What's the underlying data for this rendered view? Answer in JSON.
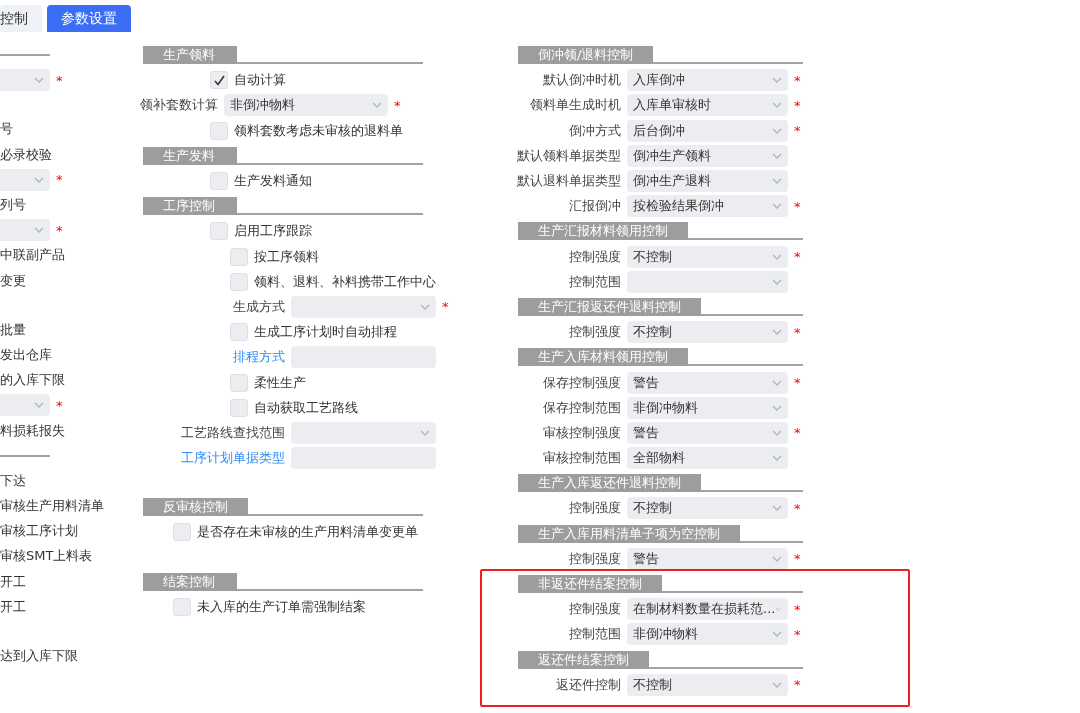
{
  "tabs": [
    {
      "label": "控制",
      "selected": false
    },
    {
      "label": "参数设置",
      "selected": true
    }
  ],
  "column_1": {
    "groups": [
      {
        "rule": true,
        "items": [
          {
            "kind": "select",
            "required_mark": "*"
          }
        ]
      },
      {
        "rule": false,
        "items": [
          {
            "kind": "text",
            "text": "号"
          },
          {
            "kind": "text",
            "text": "必录校验"
          },
          {
            "kind": "select",
            "required_mark": "*"
          },
          {
            "kind": "text",
            "text": "列号"
          },
          {
            "kind": "select",
            "required_mark": "*"
          },
          {
            "kind": "text",
            "text": "中联副产品"
          },
          {
            "kind": "text",
            "text": "变更"
          }
        ]
      },
      {
        "rule": false,
        "items": [
          {
            "kind": "text",
            "text": "批量"
          },
          {
            "kind": "text",
            "text": "发出仓库"
          },
          {
            "kind": "text",
            "text": "的入库下限"
          },
          {
            "kind": "select",
            "required_mark": "*"
          },
          {
            "kind": "text",
            "text": "料损耗报失"
          }
        ]
      },
      {
        "rule": true,
        "items": [
          {
            "kind": "text",
            "text": "下达"
          },
          {
            "kind": "text",
            "text": "审核生产用料清单"
          },
          {
            "kind": "text",
            "text": "审核工序计划"
          },
          {
            "kind": "text",
            "text": "审核SMT上料表"
          },
          {
            "kind": "text",
            "text": "开工"
          },
          {
            "kind": "text",
            "text": "开工"
          }
        ]
      },
      {
        "rule": false,
        "items": [
          {
            "kind": "text",
            "text": "达到入库下限"
          }
        ]
      }
    ]
  },
  "column_2": {
    "groups": [
      {
        "sections": [
          {
            "title": "生产领料",
            "items": [
              {
                "kind": "checkbox",
                "label": "自动计算",
                "checked": true
              },
              {
                "kind": "select",
                "label": "领补套数计算",
                "value": "非倒冲物料",
                "required_mark": "*"
              },
              {
                "kind": "checkbox",
                "label": "领料套数考虑未审核的退料单",
                "checked": false
              }
            ]
          },
          {
            "title": "生产发料",
            "items": [
              {
                "kind": "checkbox",
                "label": "生产发料通知",
                "checked": false
              }
            ]
          },
          {
            "title": "工序控制",
            "items": [
              {
                "kind": "checkbox",
                "label": "启用工序跟踪",
                "checked": false,
                "children": [
                  {
                    "kind": "checkbox",
                    "label": "按工序领料",
                    "checked": false
                  },
                  {
                    "kind": "checkbox",
                    "label": "领料、退料、补料携带工作中心",
                    "checked": false
                  },
                  {
                    "kind": "select",
                    "label": "生成方式",
                    "required_mark": "*"
                  },
                  {
                    "kind": "checkbox",
                    "label": "生成工序计划时自动排程",
                    "checked": false
                  },
                  {
                    "kind": "input",
                    "label": "排程方式",
                    "link": true
                  },
                  {
                    "kind": "checkbox",
                    "label": "柔性生产",
                    "checked": false
                  },
                  {
                    "kind": "checkbox",
                    "label": "自动获取工艺路线",
                    "checked": false
                  },
                  {
                    "kind": "select",
                    "label": "工艺路线查找范围"
                  },
                  {
                    "kind": "input",
                    "label": "工序计划单据类型",
                    "link": true
                  }
                ]
              }
            ]
          }
        ]
      },
      {
        "sections": [
          {
            "title": "反审核控制",
            "items": [
              {
                "kind": "checkbox",
                "label": "是否存在未审核的生产用料清单变更单",
                "checked": false
              }
            ]
          }
        ]
      },
      {
        "sections": [
          {
            "title": "结案控制",
            "items": [
              {
                "kind": "checkbox",
                "label": "未入库的生产订单需强制结案",
                "checked": false
              }
            ]
          }
        ]
      }
    ]
  },
  "column_3": {
    "sections": [
      {
        "title": "倒冲领/退料控制",
        "items": [
          {
            "kind": "select",
            "label": "默认倒冲时机",
            "value": "入库倒冲",
            "required_mark": "*"
          },
          {
            "kind": "select",
            "label": "领料单生成时机",
            "value": "入库单审核时",
            "required_mark": "*"
          },
          {
            "kind": "select",
            "label": "倒冲方式",
            "value": "后台倒冲",
            "required_mark": "*"
          },
          {
            "kind": "select",
            "label": "默认领料单据类型",
            "value": "倒冲生产领料"
          },
          {
            "kind": "select",
            "label": "默认退料单据类型",
            "value": "倒冲生产退料"
          },
          {
            "kind": "select",
            "label": "汇报倒冲",
            "value": "按检验结果倒冲",
            "required_mark": "*"
          }
        ]
      },
      {
        "title": "生产汇报材料领用控制",
        "items": [
          {
            "kind": "select",
            "label": "控制强度",
            "value": "不控制",
            "required_mark": "*"
          },
          {
            "kind": "select",
            "label": "控制范围"
          }
        ]
      },
      {
        "title": "生产汇报返还件退料控制",
        "items": [
          {
            "kind": "select",
            "label": "控制强度",
            "value": "不控制",
            "required_mark": "*"
          }
        ]
      },
      {
        "title": "生产入库材料领用控制",
        "items": [
          {
            "kind": "select",
            "label": "保存控制强度",
            "value": "警告",
            "required_mark": "*"
          },
          {
            "kind": "select",
            "label": "保存控制范围",
            "value": "非倒冲物料"
          },
          {
            "kind": "select",
            "label": "审核控制强度",
            "value": "警告",
            "required_mark": "*"
          },
          {
            "kind": "select",
            "label": "审核控制范围",
            "value": "全部物料"
          }
        ]
      },
      {
        "title": "生产入库返还件退料控制",
        "items": [
          {
            "kind": "select",
            "label": "控制强度",
            "value": "不控制",
            "required_mark": "*"
          }
        ]
      },
      {
        "title": "生产入库用料清单子项为空控制",
        "items": [
          {
            "kind": "select",
            "label": "控制强度",
            "value": "警告",
            "required_mark": "*"
          }
        ]
      },
      {
        "title": "非返还件结案控制",
        "items": [
          {
            "kind": "select",
            "label": "控制强度",
            "value": "在制材料数量在损耗范...",
            "required_mark": "*"
          },
          {
            "kind": "select",
            "label": "控制范围",
            "value": "非倒冲物料",
            "required_mark": "*"
          }
        ]
      },
      {
        "title": "返还件结案控制",
        "items": [
          {
            "kind": "select",
            "label": "返还件控制",
            "value": "不控制",
            "required_mark": "*"
          }
        ]
      }
    ]
  }
}
